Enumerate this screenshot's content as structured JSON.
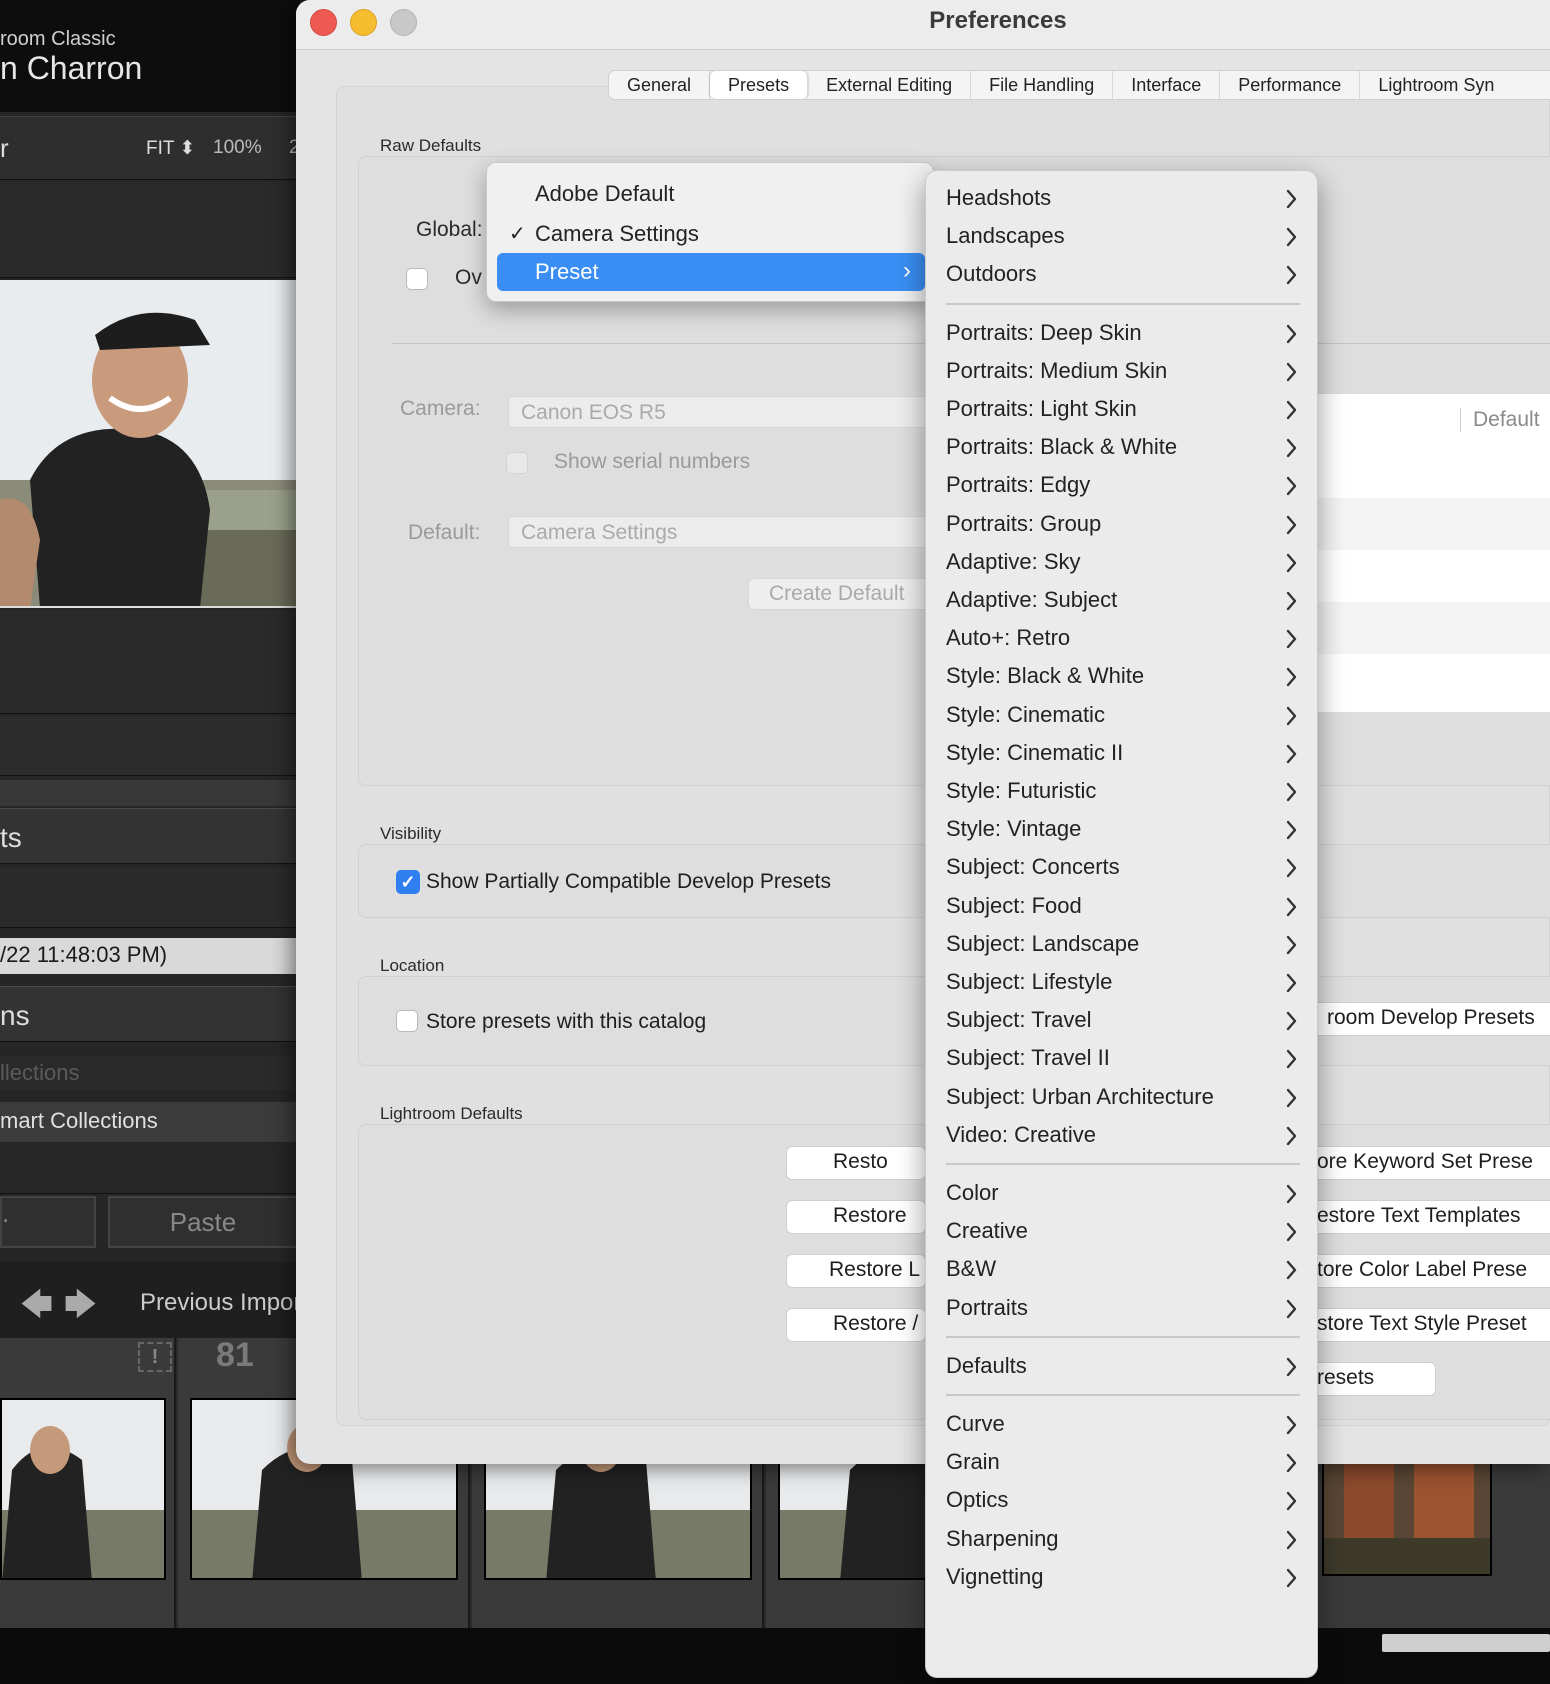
{
  "lightroom": {
    "app_title": "room Classic",
    "user_name": "n Charron",
    "navigator": {
      "label": "r",
      "fit": "FIT ⬍",
      "zoom": "100%",
      "zoom2": "2"
    },
    "presets_panel": "ts",
    "date_text": "/22 11:48:03 PM)",
    "collections_panel": "ns",
    "collections_row1": "llections",
    "collections_row2": "mart Collections",
    "copy_label": ".",
    "paste_label": "Paste",
    "previous_import": "Previous Impor",
    "film_number": "81",
    "warning_glyph": "!"
  },
  "window": {
    "title": "Preferences",
    "tabs": [
      "General",
      "Presets",
      "External Editing",
      "File Handling",
      "Interface",
      "Performance",
      "Lightroom Syn"
    ],
    "active_tab": "Presets"
  },
  "raw_defaults": {
    "group_label": "Raw Defaults",
    "global_label": "Global:",
    "override_label": "Ov",
    "camera_label": "Camera:",
    "camera_value": "Canon EOS R5",
    "show_serial_label": "Show serial numbers",
    "default_label": "Default:",
    "default_value": "Camera Settings",
    "create_default_button": "Create Default",
    "table_column_default": "Default"
  },
  "visibility": {
    "group_label": "Visibility",
    "show_partial_label": "Show Partially Compatible Develop Presets",
    "show_partial_checked": true
  },
  "location": {
    "group_label": "Location",
    "store_with_catalog_label": "Store presets with this catalog",
    "store_with_catalog_checked": false,
    "show_presets_button": "room Develop Presets"
  },
  "lightroom_defaults": {
    "group_label": "Lightroom Defaults",
    "left_buttons": [
      "Resto",
      "Restore",
      "Restore L",
      "Restore /"
    ],
    "right_buttons": [
      "ore Keyword Set Prese",
      "estore Text Templates",
      "tore Color Label Prese",
      "store Text Style Preset",
      "resets"
    ]
  },
  "global_popup": {
    "items": [
      {
        "label": "Adobe Default",
        "checked": false,
        "selected": false
      },
      {
        "label": "Camera Settings",
        "checked": true,
        "selected": false
      },
      {
        "label": "Preset",
        "checked": false,
        "selected": true,
        "has_submenu": true
      }
    ],
    "check_glyph": "✓",
    "chevron_glyph": "›"
  },
  "preset_submenu": {
    "groups": [
      [
        "Headshots",
        "Landscapes",
        "Outdoors"
      ],
      [
        "Portraits: Deep Skin",
        "Portraits: Medium Skin",
        "Portraits: Light Skin",
        "Portraits: Black & White",
        "Portraits: Edgy",
        "Portraits: Group",
        "Adaptive: Sky",
        "Adaptive: Subject",
        "Auto+: Retro",
        "Style: Black & White",
        "Style: Cinematic",
        "Style: Cinematic II",
        "Style: Futuristic",
        "Style: Vintage",
        "Subject: Concerts",
        "Subject: Food",
        "Subject: Landscape",
        "Subject: Lifestyle",
        "Subject: Travel",
        "Subject: Travel II",
        "Subject: Urban Architecture",
        "Video: Creative"
      ],
      [
        "Color",
        "Creative",
        "B&W",
        "Portraits"
      ],
      [
        "Defaults"
      ],
      [
        "Curve",
        "Grain",
        "Optics",
        "Sharpening",
        "Vignetting"
      ]
    ]
  },
  "colors": {
    "accent_blue": "#3a8ef3",
    "checkbox_blue": "#2f7ff0",
    "close": "#ee5a52",
    "minimize": "#f5bd2f",
    "maximize": "#c8c8c8"
  }
}
